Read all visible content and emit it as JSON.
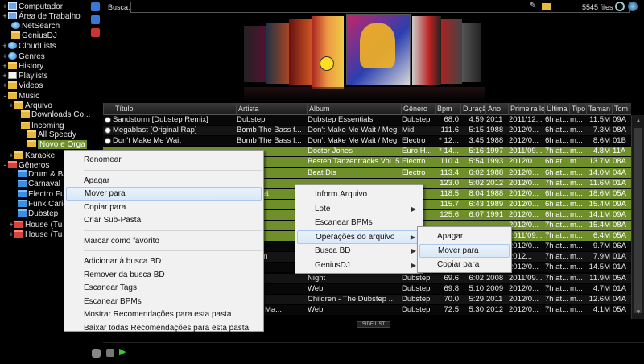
{
  "tree": [
    {
      "label": "Computador",
      "icon": "pc",
      "exp": "+"
    },
    {
      "label": "Área de Trabalho",
      "icon": "pc",
      "exp": "+"
    },
    {
      "label": "NetSearch",
      "icon": "globe",
      "exp": ""
    },
    {
      "label": "GeniusDJ",
      "icon": "folder",
      "exp": ""
    },
    {
      "label": "CloudLists",
      "icon": "globe",
      "exp": "+"
    },
    {
      "label": "Genres",
      "icon": "globe",
      "exp": "+"
    },
    {
      "label": "History",
      "icon": "folder",
      "exp": "+"
    },
    {
      "label": "Playlists",
      "icon": "doc",
      "exp": "+"
    },
    {
      "label": "Videos",
      "icon": "folder",
      "exp": "+"
    },
    {
      "label": "Music",
      "icon": "folder",
      "exp": "-"
    },
    {
      "label": "Arquivo",
      "icon": "folder",
      "exp": "+"
    },
    {
      "label": "Downloads Co...",
      "icon": "folder",
      "exp": ""
    },
    {
      "label": "Incoming",
      "icon": "folder",
      "exp": "-"
    },
    {
      "label": "All Speedy",
      "icon": "folder",
      "exp": ""
    },
    {
      "label": "Novo e Orga",
      "icon": "folder",
      "exp": "",
      "selected": true
    },
    {
      "label": "Karaoke",
      "icon": "folder",
      "exp": "+"
    },
    {
      "label": "Gêneros",
      "icon": "folder-red",
      "exp": "-"
    },
    {
      "label": "Drum & Ba",
      "icon": "folder-blue",
      "exp": ""
    },
    {
      "label": "Carnaval",
      "icon": "folder-blue",
      "exp": ""
    },
    {
      "label": "Electro Fun",
      "icon": "folder-blue",
      "exp": ""
    },
    {
      "label": "Funk Carioc",
      "icon": "folder-blue",
      "exp": ""
    },
    {
      "label": "Dubstep",
      "icon": "folder-blue",
      "exp": ""
    },
    {
      "label": "House (Tu",
      "icon": "folder-red",
      "exp": "+"
    },
    {
      "label": "House (Tu",
      "icon": "folder-red",
      "exp": "+"
    }
  ],
  "search": {
    "label": "Busca:",
    "value": "",
    "files": "5545 files"
  },
  "columns": [
    "Título",
    "Artista",
    "Álbum",
    "Gênero",
    "Bpm",
    "Duraçã",
    "Ano",
    "Primeira lo",
    "Última",
    "Tipo",
    "Taman",
    "Tom"
  ],
  "rows": [
    {
      "t": "Sandstorm [Dubstep Remix]",
      "a": "Dubstep",
      "al": "Dubstep Essentials",
      "g": "Dubstep",
      "b": "68.0",
      "d": "4:59",
      "y": "2011",
      "p": "2011/12...",
      "u": "6h at...",
      "tp": "m...",
      "s": "11.5M",
      "k": "09A",
      "icon": true
    },
    {
      "t": "Megablast [Original Rap]",
      "a": "Bomb The Bass f...",
      "al": "Don't Make Me Wait / Meg...",
      "g": "Mid",
      "b": "111.6",
      "d": "5:15",
      "y": "1988",
      "p": "2012/0...",
      "u": "6h at...",
      "tp": "m...",
      "s": "7.3M",
      "k": "08A",
      "icon": true
    },
    {
      "t": "Don't Make Me Wait",
      "a": "Bomb The Bass f...",
      "al": "Don't Make Me Wait / Meg...",
      "g": "Electro",
      "b": "* 12...",
      "d": "3:45",
      "y": "1988",
      "p": "2012/0...",
      "u": "6h at...",
      "tp": "m...",
      "s": "8.6M",
      "k": "01B",
      "icon": true
    },
    {
      "t": "",
      "a": "",
      "al": "Doctor Jones",
      "g": "Euro H...",
      "b": "* 14...",
      "d": "5:16",
      "y": "1997",
      "p": "2011/09...",
      "u": "7h at...",
      "tp": "m...",
      "s": "4.8M",
      "k": "11A",
      "green": true
    },
    {
      "t": "",
      "a": "p Boys",
      "al": "Besten Tanzentracks Vol. 5",
      "g": "Electro",
      "b": "110.4",
      "d": "5:54",
      "y": "1993",
      "p": "2012/0...",
      "u": "6h at...",
      "tp": "m...",
      "s": "13.7M",
      "k": "08A",
      "green": true
    },
    {
      "t": "",
      "a": "e Bass",
      "al": "Beat Dis",
      "g": "Electro",
      "b": "113.4",
      "d": "6:02",
      "y": "1988",
      "p": "2012/0...",
      "u": "6h at...",
      "tp": "m...",
      "s": "14.0M",
      "k": "04A",
      "green": true
    },
    {
      "t": "",
      "a": "",
      "al": "",
      "g": "",
      "b": "123.0",
      "d": "5:02",
      "y": "2012",
      "p": "2012/0...",
      "u": "7h at...",
      "tp": "m...",
      "s": "11.6M",
      "k": "01A",
      "green": true
    },
    {
      "t": "",
      "a": "on Societ",
      "al": "",
      "g": "",
      "b": "118.5",
      "d": "8:04",
      "y": "1988",
      "p": "2012/0...",
      "u": "6h at...",
      "tp": "m...",
      "s": "18.6M",
      "k": "05A",
      "green": true
    },
    {
      "t": "",
      "a": "",
      "al": "",
      "g": "op",
      "b": "115.7",
      "d": "6:43",
      "y": "1989",
      "p": "2012/0...",
      "u": "6h at...",
      "tp": "m...",
      "s": "15.4M",
      "k": "09A",
      "green": true
    },
    {
      "t": "",
      "a": "TV",
      "al": "",
      "g": "",
      "b": "125.6",
      "d": "6:07",
      "y": "1991",
      "p": "2012/0...",
      "u": "6h at...",
      "tp": "m...",
      "s": "14.1M",
      "k": "09A",
      "green": true
    },
    {
      "t": "",
      "a": "a J.B.",
      "al": "",
      "g": "",
      "b": "",
      "d": "",
      "y": "",
      "p": "2012/0...",
      "u": "7h at...",
      "tp": "m...",
      "s": "15.4M",
      "k": "08A",
      "green": true
    },
    {
      "t": "",
      "a": "",
      "al": "",
      "g": "",
      "b": "",
      "d": "",
      "y": "",
      "p": "2011/09...",
      "u": "7h at...",
      "tp": "m...",
      "s": "6.4M",
      "k": "05A",
      "green": true
    },
    {
      "t": "",
      "a": "e Bass",
      "al": "",
      "g": "",
      "b": "",
      "d": "",
      "y": "",
      "p": "2012/0...",
      "u": "7h at...",
      "tp": "m...",
      "s": "9.7M",
      "k": "06A"
    },
    {
      "t": "",
      "a": "n Buuren",
      "al": "",
      "g": "",
      "b": "",
      "d": "",
      "y": "",
      "p": "2012...",
      "u": "7h at...",
      "tp": "m...",
      "s": "7.9M",
      "k": "01A"
    },
    {
      "t": "",
      "a": "",
      "al": "",
      "g": "",
      "b": "",
      "d": "",
      "y": "",
      "p": "2012/0...",
      "u": "7h at...",
      "tp": "m...",
      "s": "14.5M",
      "k": "01A"
    },
    {
      "t": "",
      "a": ". Coki",
      "al": "Night",
      "g": "Dubstep",
      "b": "69.6",
      "d": "6:02",
      "y": "2008",
      "p": "2011/09...",
      "u": "7h at...",
      "tp": "m...",
      "s": "11.9M",
      "k": "05A"
    },
    {
      "t": "",
      "a": "y",
      "al": "Web",
      "g": "Dubstep",
      "b": "69.8",
      "d": "5:10",
      "y": "2009",
      "p": "2012/0...",
      "u": "7h at...",
      "tp": "m...",
      "s": "4.7M",
      "k": "01A"
    },
    {
      "t": "",
      "a": "Miles",
      "al": "Children - The Dubstep ...",
      "g": "Dubstep",
      "b": "70.0",
      "d": "5:29",
      "y": "2011",
      "p": "2012/0...",
      "u": "7h at...",
      "tp": "m...",
      "s": "12.6M",
      "k": "04A"
    },
    {
      "t": "",
      "a": "e + The Ma...",
      "al": "Web",
      "g": "Dubstep",
      "b": "72.5",
      "d": "5:30",
      "y": "2012",
      "p": "2012/0...",
      "u": "7h at...",
      "tp": "m...",
      "s": "4.1M",
      "k": "05A"
    }
  ],
  "menu1": [
    {
      "label": "Renomear"
    },
    {
      "sep": true
    },
    {
      "label": "Apagar"
    },
    {
      "label": "Mover para",
      "hl": true
    },
    {
      "label": "Copiar para"
    },
    {
      "label": "Criar Sub-Pasta"
    },
    {
      "sep": true
    },
    {
      "label": "Marcar como favorito"
    },
    {
      "sep": true
    },
    {
      "label": "Adicionar à  busca BD"
    },
    {
      "label": "Remover da busca BD"
    },
    {
      "label": "Escanear Tags"
    },
    {
      "label": "Escanear BPMs"
    },
    {
      "label": "Mostrar Recomendações para esta pasta"
    },
    {
      "label": "Baixar todas Recomendações para esta pasta"
    }
  ],
  "menu2": [
    {
      "label": "Inform.Arquivo"
    },
    {
      "label": "Lote",
      "sub": true
    },
    {
      "label": "Escanear BPMs"
    },
    {
      "label": "Operações do arquivo",
      "sub": true,
      "hl": true
    },
    {
      "label": "Busca BD",
      "sub": true
    },
    {
      "label": "GeniusDJ",
      "sub": true
    }
  ],
  "menu3": [
    {
      "label": "Apagar"
    },
    {
      "label": "Mover para",
      "hl": true
    },
    {
      "label": "Copiar para"
    }
  ],
  "bottom": {
    "sidelist": "SIDE LIST"
  },
  "colors": {
    "selection_green": "#6f8f2a",
    "menu_bg": "#f1f1f1",
    "menu_highlight": "#d9e8f7"
  }
}
